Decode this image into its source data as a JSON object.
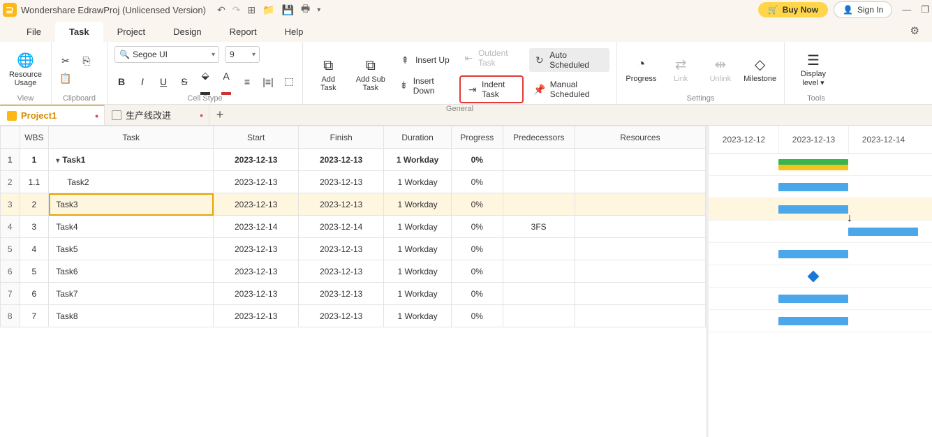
{
  "title": "Wondershare EdrawProj (Unlicensed Version)",
  "titlebar_buttons": {
    "buy": "Buy Now",
    "signin": "Sign In"
  },
  "menus": {
    "file": "File",
    "task": "Task",
    "project": "Project",
    "design": "Design",
    "report": "Report",
    "help": "Help"
  },
  "ribbon": {
    "view": {
      "resource_usage": "Resource\nUsage",
      "label": "View"
    },
    "clipboard": {
      "label": "Clipboard"
    },
    "cellstyle": {
      "font": "Segoe UI",
      "size": "9",
      "label": "Cell Stype"
    },
    "general": {
      "add_task": "Add\nTask",
      "add_sub": "Add Sub\nTask",
      "insert_up": "Insert Up",
      "insert_down": "Insert Down",
      "outdent": "Outdent Task",
      "indent": "Indent Task",
      "auto": "Auto Scheduled",
      "manual": "Manual Scheduled",
      "label": "General"
    },
    "settings": {
      "progress": "Progress",
      "link": "Link",
      "unlink": "Unlink",
      "milestone": "Milestone",
      "label": "Settings"
    },
    "tools": {
      "display": "Display\nlevel",
      "label": "Tools"
    }
  },
  "doctabs": {
    "t1": "Project1",
    "t2": "生产线改进"
  },
  "columns": {
    "wbs": "WBS",
    "task": "Task",
    "start": "Start",
    "finish": "Finish",
    "duration": "Duration",
    "progress": "Progress",
    "pred": "Predecessors",
    "res": "Resources"
  },
  "rows": [
    {
      "n": "1",
      "wbs": "1",
      "name": "Task1",
      "start": "2023-12-13",
      "finish": "2023-12-13",
      "dur": "1 Workday",
      "prog": "0%",
      "pred": "",
      "summary": true
    },
    {
      "n": "2",
      "wbs": "1.1",
      "name": "Task2",
      "start": "2023-12-13",
      "finish": "2023-12-13",
      "dur": "1 Workday",
      "prog": "0%",
      "pred": "",
      "indent": true
    },
    {
      "n": "3",
      "wbs": "2",
      "name": "Task3",
      "start": "2023-12-13",
      "finish": "2023-12-13",
      "dur": "1 Workday",
      "prog": "0%",
      "pred": "",
      "selected": true
    },
    {
      "n": "4",
      "wbs": "3",
      "name": "Task4",
      "start": "2023-12-14",
      "finish": "2023-12-14",
      "dur": "1 Workday",
      "prog": "0%",
      "pred": "3FS"
    },
    {
      "n": "5",
      "wbs": "4",
      "name": "Task5",
      "start": "2023-12-13",
      "finish": "2023-12-13",
      "dur": "1 Workday",
      "prog": "0%",
      "pred": ""
    },
    {
      "n": "6",
      "wbs": "5",
      "name": "Task6",
      "start": "2023-12-13",
      "finish": "2023-12-13",
      "dur": "1 Workday",
      "prog": "0%",
      "pred": "",
      "milestone": true
    },
    {
      "n": "7",
      "wbs": "6",
      "name": "Task7",
      "start": "2023-12-13",
      "finish": "2023-12-13",
      "dur": "1 Workday",
      "prog": "0%",
      "pred": ""
    },
    {
      "n": "8",
      "wbs": "7",
      "name": "Task8",
      "start": "2023-12-13",
      "finish": "2023-12-13",
      "dur": "1 Workday",
      "prog": "0%",
      "pred": ""
    }
  ],
  "gantt_days": [
    "2023-12-12",
    "2023-12-13",
    "2023-12-14"
  ]
}
